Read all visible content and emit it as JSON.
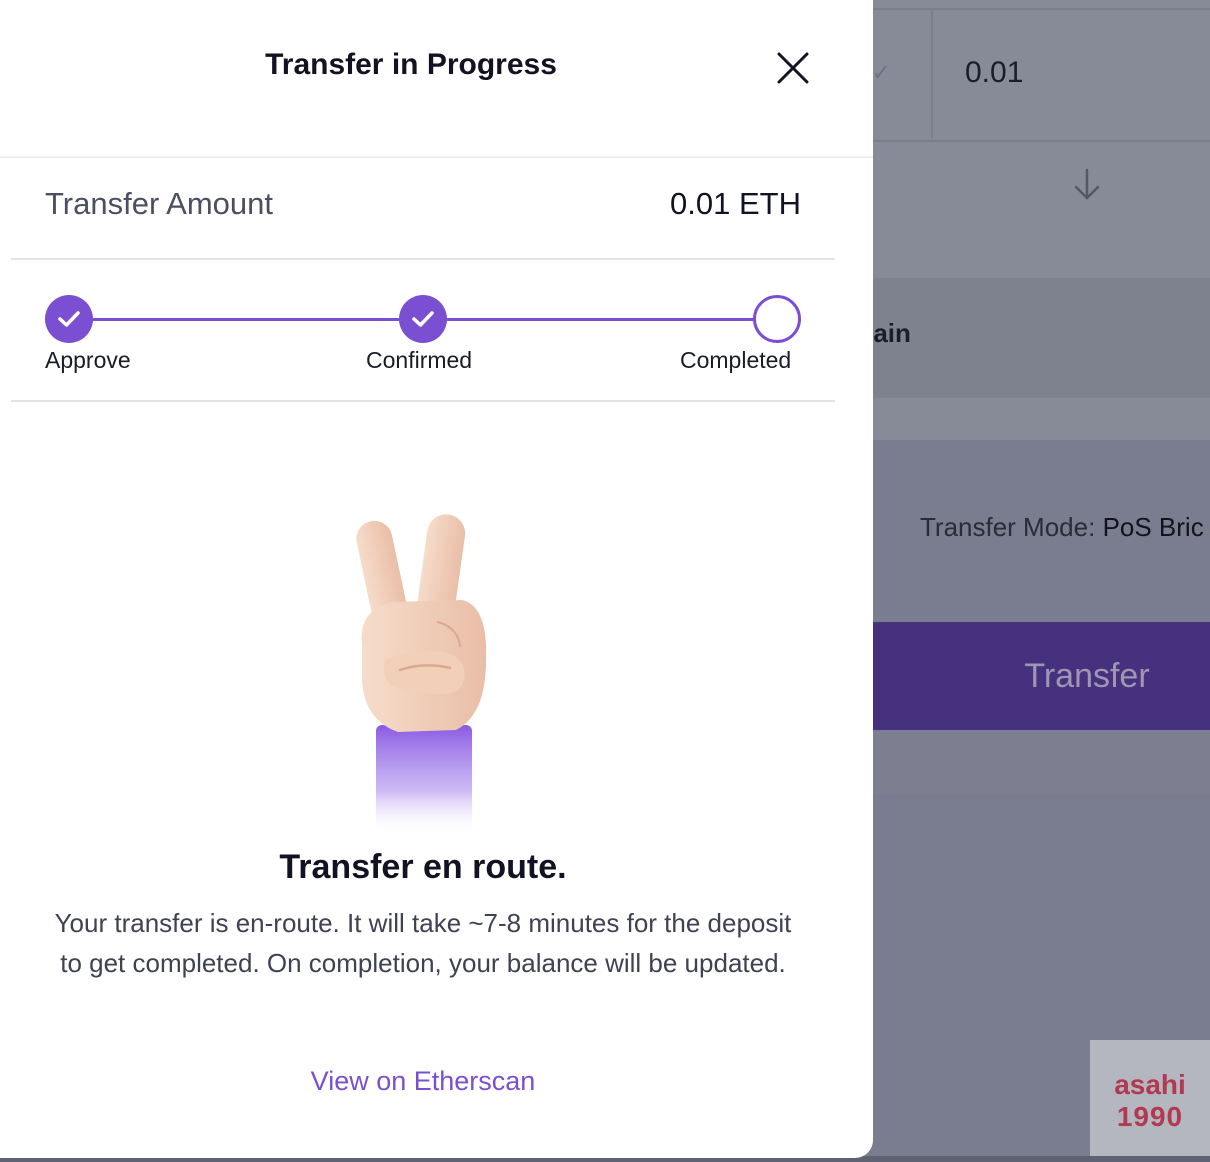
{
  "background": {
    "amount": "0.01",
    "chain_partial": "chain",
    "transfer_mode_label": "Transfer Mode:",
    "transfer_mode_value": "PoS Bric",
    "transfer_button": "Transfer",
    "watermark_line1": "asahi",
    "watermark_line2": "1990"
  },
  "modal": {
    "title": "Transfer in Progress",
    "amount_label": "Transfer Amount",
    "amount_value": "0.01 ETH",
    "steps": [
      {
        "label": "Approve",
        "status": "done"
      },
      {
        "label": "Confirmed",
        "status": "done"
      },
      {
        "label": "Completed",
        "status": "pending"
      }
    ],
    "status_title": "Transfer en route.",
    "status_description": "Your transfer is en-route. It will take ~7-8 minutes for the deposit to get completed. On completion, your balance will be updated.",
    "link_label": "View on Etherscan"
  },
  "colors": {
    "accent": "#7b4fd1",
    "overlay": "#7a7d8e",
    "transfer_button_bg": "#46317f"
  },
  "icons": [
    "close-icon",
    "check-icon",
    "arrow-down-icon",
    "peace-hand-illustration"
  ]
}
